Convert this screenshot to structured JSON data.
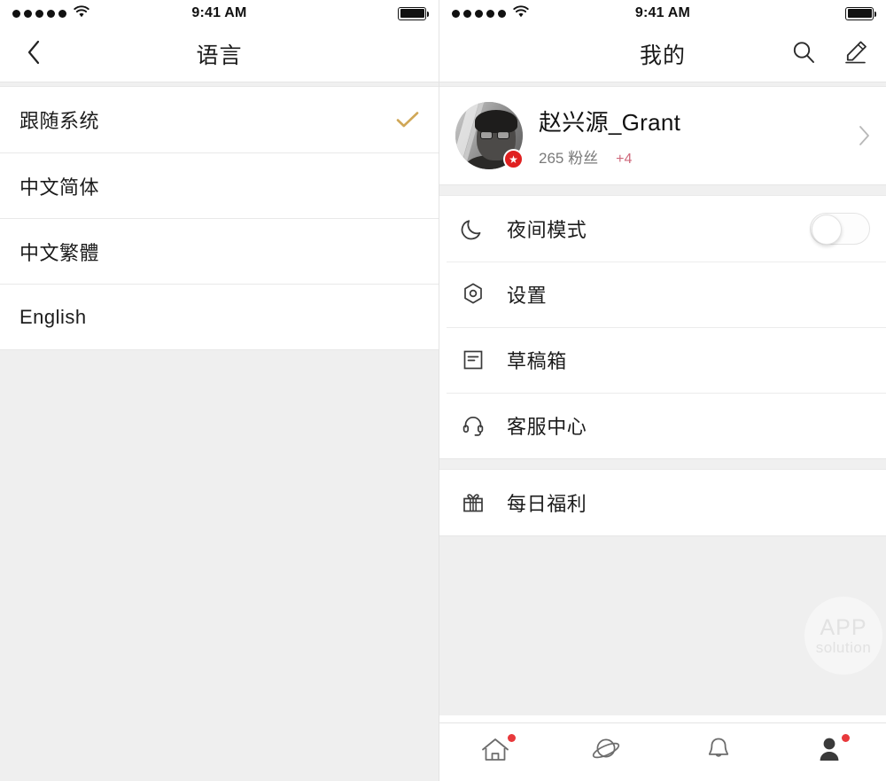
{
  "left": {
    "status": {
      "time": "9:41 AM",
      "signal_dots": 5,
      "wifi": "wifi-icon",
      "battery": "battery-full-icon"
    },
    "nav": {
      "back": "back-chevron-icon",
      "title": "语言"
    },
    "options": [
      {
        "label": "跟随系统",
        "selected": true
      },
      {
        "label": "中文简体",
        "selected": false
      },
      {
        "label": "中文繁體",
        "selected": false
      },
      {
        "label": "English",
        "selected": false
      }
    ],
    "check_color": "#d0a757"
  },
  "right": {
    "status": {
      "time": "9:41 AM",
      "signal_dots": 5,
      "wifi": "wifi-icon",
      "battery": "battery-full-icon"
    },
    "nav": {
      "title": "我的",
      "search": "search-icon",
      "compose": "pencil-icon"
    },
    "profile": {
      "name": "赵兴源_Grant",
      "fans": "265 粉丝",
      "fans_delta": "+4",
      "badge": "★",
      "badge_color": "#e02020",
      "delta_color": "#cf6a7c",
      "chevron": "chevron-right-icon"
    },
    "menu_group_1": [
      {
        "label": "夜间模式",
        "icon": "moon-icon",
        "control": "toggle",
        "toggle_on": false
      },
      {
        "label": "设置",
        "icon": "gear-icon",
        "control": "none"
      },
      {
        "label": "草稿箱",
        "icon": "draft-document-icon",
        "control": "none"
      },
      {
        "label": "客服中心",
        "icon": "headset-icon",
        "control": "none"
      }
    ],
    "menu_group_2": [
      {
        "label": "每日福利",
        "icon": "gift-icon",
        "control": "none"
      }
    ],
    "watermark": {
      "line1": "APP",
      "line2": "solution"
    },
    "tabs": [
      {
        "name": "home",
        "icon": "home-icon",
        "active": false,
        "dot": true
      },
      {
        "name": "discover",
        "icon": "planet-icon",
        "active": false,
        "dot": false
      },
      {
        "name": "notifications",
        "icon": "bell-icon",
        "active": false,
        "dot": false
      },
      {
        "name": "profile",
        "icon": "person-icon",
        "active": true,
        "dot": true
      }
    ]
  }
}
